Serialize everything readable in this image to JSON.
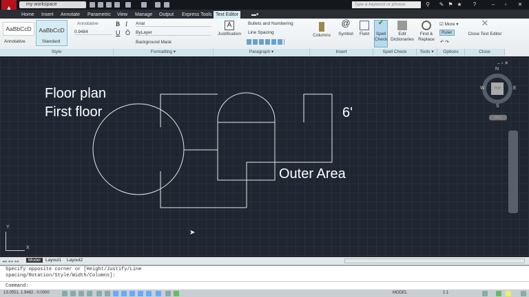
{
  "title_bar": {
    "workspace": "my workspace",
    "search_placeholder": "Type a keyword or phrase"
  },
  "tabs": [
    "Home",
    "Insert",
    "Annotate",
    "Parametric",
    "View",
    "Manage",
    "Output",
    "Express Tools",
    "Text Editor"
  ],
  "ribbon": {
    "style": {
      "sample1": "AaBbCcD",
      "sample2": "AaBbCcD",
      "label1": "Annotative",
      "label2": "Standard",
      "annotative": "Annotative",
      "height": "0.9484",
      "panel": "Style"
    },
    "formatting": {
      "bold": "B",
      "italic": "I",
      "underline": "U",
      "overline": "Ō",
      "font": "Arial",
      "color": "ByLayer",
      "background_mask": "Background Mask",
      "panel": "Formatting ▾"
    },
    "paragraph": {
      "justification": "Justification",
      "bullets": "Bullets and Numbering",
      "line_spacing": "Line Spacing",
      "panel": "Paragraph ▾"
    },
    "insert": {
      "columns": "Columns",
      "symbol": "Symbol",
      "field": "Field",
      "panel": "Insert"
    },
    "spell": {
      "spell_check": "Spell Check",
      "edit_dict": "Edit Dictionaries",
      "panel": "Spell Check"
    },
    "tools": {
      "find_replace": "Find & Replace",
      "panel": "Tools ▾"
    },
    "options": {
      "more": "More",
      "ruler": "Ruler",
      "panel": "Options"
    },
    "close": {
      "close_editor": "Close Text Editor",
      "panel": "Close"
    }
  },
  "drawing": {
    "line1": "Floor plan",
    "line2": "First floor",
    "dim": "6'",
    "outer": "Outer Area"
  },
  "viewcube": {
    "n": "N",
    "s": "S",
    "e": "E",
    "w": "W",
    "top": "TOP",
    "wcs": "WCS"
  },
  "ucs": {
    "x": "X",
    "y": "Y"
  },
  "layout_tabs": [
    "Model",
    "Layout1",
    "Layout2"
  ],
  "command": {
    "history1": "Specify opposite corner or [Height/Justify/Line",
    "history2": "spacing/Rotation/Style/Width/Columns]:",
    "prompt": "Command:"
  },
  "status": {
    "coords": "13.0551, 1.9482 , 0.0000",
    "model": "MODEL",
    "scale": "1:1"
  }
}
